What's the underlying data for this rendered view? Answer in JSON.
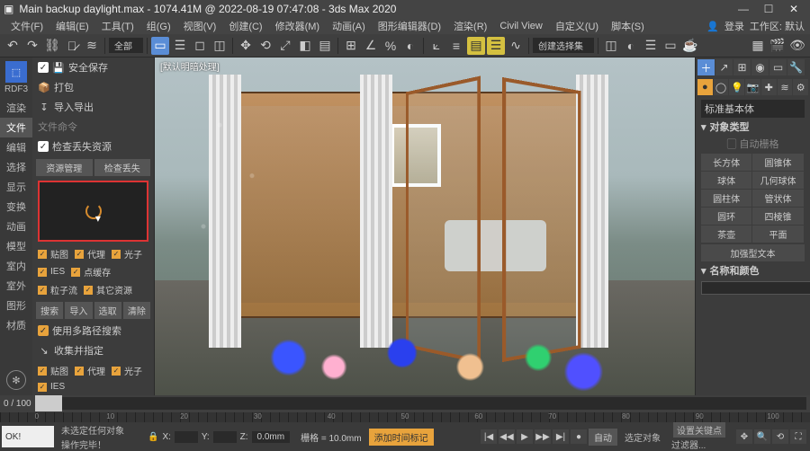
{
  "title": "Main backup daylight.max - 1074.41M @ 2022-08-19 07:47:08 - 3ds Max 2020",
  "menus": [
    "文件(F)",
    "编辑(E)",
    "工具(T)",
    "组(G)",
    "视图(V)",
    "创建(C)",
    "修改器(M)",
    "动画(A)",
    "图形编辑器(D)",
    "渲染(R)",
    "Civil View",
    "自定义(U)",
    "脚本(S)"
  ],
  "menu_right": {
    "login": "登录",
    "ws": "工作区: 默认"
  },
  "toolbar": {
    "dropdown": "全部",
    "create_sel": "创建选择集"
  },
  "left_tabs": {
    "label": "RDF3",
    "items": [
      "渲染",
      "文件",
      "编辑",
      "选择",
      "显示",
      "变换",
      "动画",
      "模型",
      "室内",
      "室外",
      "图形",
      "材质"
    ]
  },
  "plugin": {
    "safe_save": "安全保存",
    "pack": "打包",
    "import_export": "导入导出",
    "file_name": "文件命令",
    "check_lost": "检查丢失资源",
    "tab_resmgr": "资源管理",
    "tab_checklost": "检查丢失",
    "grid1": [
      "贴图",
      "代理",
      "光子",
      "IES",
      "点缓存",
      "粒子流",
      "其它资源"
    ],
    "btns": [
      "搜索",
      "导入",
      "选取",
      "清除"
    ],
    "multi_search": "使用多路径搜索",
    "collect_assign": "收集并指定",
    "grid2": [
      "贴图",
      "代理",
      "光子",
      "IES"
    ]
  },
  "viewport_label": "[默认明暗处理]",
  "cmd": {
    "std_prim": "标准基本体",
    "obj_type_head": "对象类型",
    "auto_grid": "自动栅格",
    "prims": [
      "长方体",
      "圆锥体",
      "球体",
      "几何球体",
      "圆柱体",
      "管状体",
      "圆环",
      "四棱锥",
      "茶壶",
      "平面"
    ],
    "text_plus": "加强型文本",
    "name_color_head": "名称和颜色"
  },
  "timeline": {
    "range": "0 / 100",
    "cur": "0",
    "transport": [
      "|◀",
      "◀◀",
      "▶",
      "▶▶",
      "▶|",
      "●"
    ],
    "auto": "自动",
    "selected": "选定对象",
    "setkey": "设置关键点",
    "filter": "过滤器...",
    "grid": "栅格 = 10.0mm",
    "addtag": "添加时间标记"
  },
  "status": {
    "ok": "OK!",
    "none_sel": "未选定任何对象",
    "done": "操作完毕！",
    "x": "X:",
    "y": "Y:",
    "z": "Z:",
    "zv": "0.0mm"
  },
  "ruler": [
    "0",
    "10",
    "20",
    "30",
    "40",
    "50",
    "60",
    "70",
    "80",
    "90",
    "100"
  ]
}
